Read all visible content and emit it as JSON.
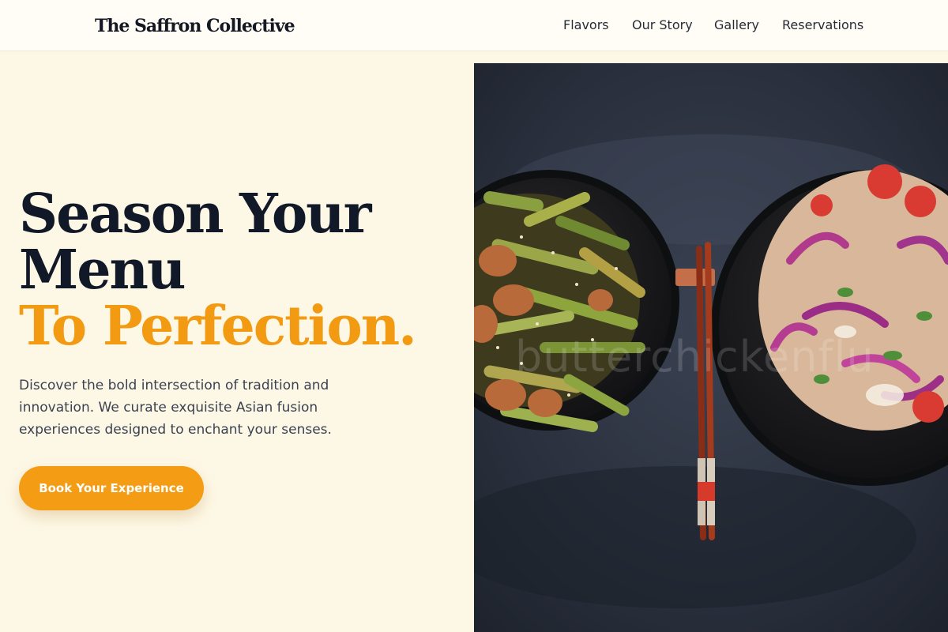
{
  "brand": {
    "name": "The Saffron Collective"
  },
  "nav": {
    "links": [
      "Flavors",
      "Our Story",
      "Gallery",
      "Reservations"
    ]
  },
  "hero": {
    "headline_line1": "Season Your",
    "headline_line2": "Menu",
    "headline_accent": "To Perfection.",
    "description": "Discover the bold intersection of tradition and innovation. We curate exquisite Asian fusion experiences designed to enchant your senses.",
    "cta_label": "Book Your Experience",
    "image_watermark": "butterchickenflu"
  },
  "colors": {
    "accent": "#f29a12",
    "headline": "#111827",
    "background": "#fdf8e6",
    "button_text": "#ffffff"
  },
  "icons": {
    "hero_image": "food-photo-two-bowls-chopsticks"
  }
}
